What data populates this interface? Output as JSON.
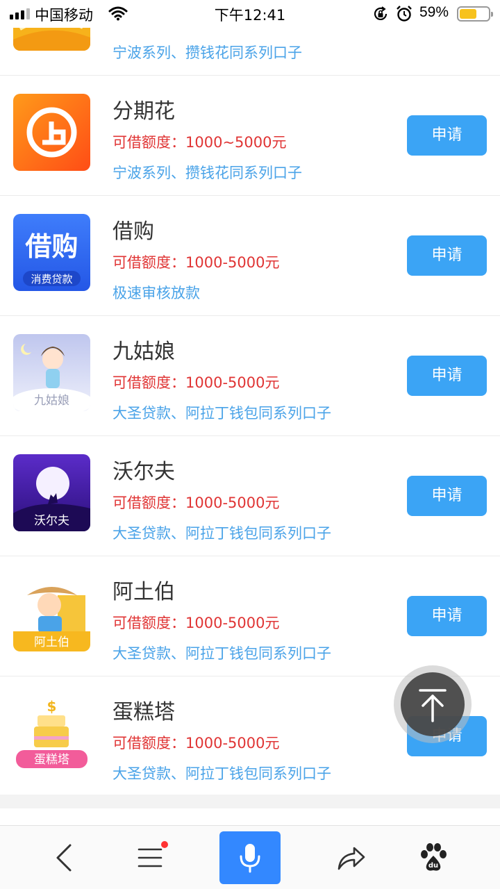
{
  "status_bar": {
    "carrier": "中国移动",
    "time": "下午12:41",
    "battery_percent": "59%",
    "battery_level": 0.59
  },
  "apply_label": "申请",
  "partial_row": {
    "desc": "宁波系列、攒钱花同系列口子"
  },
  "apps": [
    {
      "name": "分期花",
      "quota": "可借额度：1000~5000元",
      "desc": "宁波系列、攒钱花同系列口子",
      "icon": "fenqihua-logo-icon"
    },
    {
      "name": "借购",
      "quota": "可借额度：1000-5000元",
      "desc": "极速审核放款",
      "icon": "jiegou-logo-icon",
      "icon_text": "借购",
      "icon_subtext": "消费贷款"
    },
    {
      "name": "九姑娘",
      "quota": "可借额度：1000-5000元",
      "desc": "大圣贷款、阿拉丁钱包同系列口子",
      "icon": "jiuguniang-logo-icon",
      "icon_text": "九姑娘"
    },
    {
      "name": "沃尔夫",
      "quota": "可借额度：1000-5000元",
      "desc": "大圣贷款、阿拉丁钱包同系列口子",
      "icon": "woerfu-logo-icon",
      "icon_text": "沃尔夫"
    },
    {
      "name": "阿土伯",
      "quota": "可借额度：1000-5000元",
      "desc": "大圣贷款、阿拉丁钱包同系列口子",
      "icon": "atubo-logo-icon",
      "icon_text": "阿土伯"
    },
    {
      "name": "蛋糕塔",
      "quota": "可借额度：1000-5000元",
      "desc": "大圣贷款、阿拉丁钱包同系列口子",
      "icon": "dangaota-logo-icon",
      "icon_text": "蛋糕塔"
    }
  ],
  "toolbar": {
    "items": [
      "back-icon",
      "menu-icon",
      "microphone-icon",
      "share-icon",
      "baidu-paw-icon"
    ]
  },
  "colors": {
    "apply_button": "#3ba4f5",
    "quota_text": "#e03434",
    "desc_text": "#4aa3e8",
    "voice_button": "#3388ff"
  }
}
